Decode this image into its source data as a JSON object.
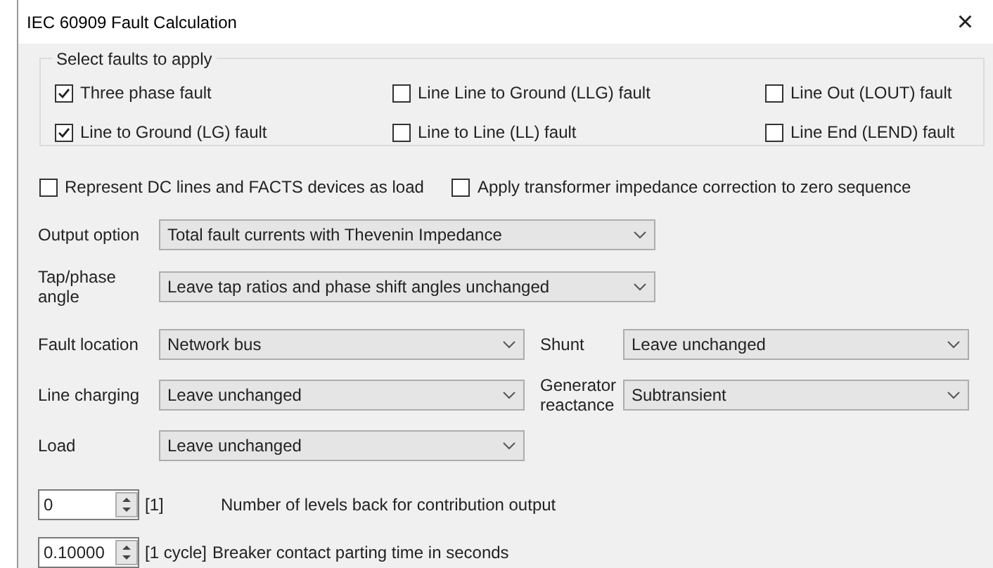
{
  "window": {
    "title": "IEC 60909 Fault Calculation",
    "close": "×"
  },
  "fault_group": {
    "title": "Select faults to apply",
    "faults": [
      {
        "label": "Three phase fault",
        "checked": true
      },
      {
        "label": "Line Line to Ground (LLG) fault",
        "checked": false
      },
      {
        "label": "Line Out (LOUT) fault",
        "checked": false
      },
      {
        "label": "Line to Ground (LG) fault",
        "checked": true
      },
      {
        "label": "Line to Line (LL) fault",
        "checked": false
      },
      {
        "label": "Line End (LEND) fault",
        "checked": false
      }
    ]
  },
  "options": [
    {
      "label": "Represent DC lines and FACTS devices as load",
      "checked": false
    },
    {
      "label": "Apply transformer impedance correction to zero sequence",
      "checked": false
    }
  ],
  "wide_selects": [
    {
      "label": "Output option",
      "value": "Total fault currents with Thevenin Impedance"
    },
    {
      "label": "Tap/phase angle",
      "value": "Leave tap ratios and phase shift angles unchanged"
    }
  ],
  "grid_selects": [
    {
      "label": "Fault location",
      "value": "Network bus"
    },
    {
      "label": "Shunt",
      "value": "Leave unchanged"
    },
    {
      "label": "Line charging",
      "value": "Leave unchanged"
    },
    {
      "label": "Generator reactance",
      "value": "Subtransient"
    },
    {
      "label": "Load",
      "value": "Leave unchanged"
    }
  ],
  "spinners": [
    {
      "value": "0",
      "unit": "[1]",
      "description": "Number of levels back for contribution output"
    },
    {
      "value": "0.10000",
      "unit": "[1 cycle]",
      "description": "Breaker contact parting time in seconds"
    }
  ]
}
